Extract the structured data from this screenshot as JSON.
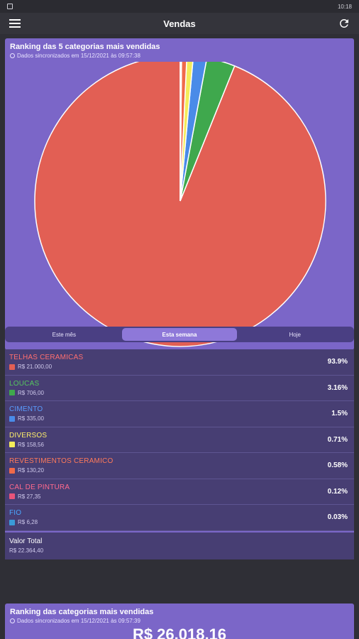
{
  "status": {
    "time": "10:18"
  },
  "appbar": {
    "title": "Vendas",
    "menu_icon": "menu-icon",
    "refresh_icon": "refresh-icon"
  },
  "card1": {
    "title": "Ranking das 5 categorias mais vendidas",
    "synced": "Dados sincronizados em 15/12/2021 às 09:57:38"
  },
  "chart_data": {
    "type": "pie",
    "slices": [
      {
        "label": "TELHAS CERAMICAS",
        "value": 93.9,
        "color": "#e25f54"
      },
      {
        "label": "LOUCAS",
        "value": 3.16,
        "color": "#3fa84d"
      },
      {
        "label": "CIMENTO",
        "value": 1.5,
        "color": "#4a8be8"
      },
      {
        "label": "DIVERSOS",
        "value": 0.71,
        "color": "#f4ec5a"
      },
      {
        "label": "REVESTIMENTOS CERAMICO",
        "value": 0.58,
        "color": "#f06a4a"
      },
      {
        "label": "CAL DE PINTURA",
        "value": 0.12,
        "color": "#e8547a"
      },
      {
        "label": "FIO",
        "value": 0.03,
        "color": "#3a9ad8"
      }
    ]
  },
  "period_tabs": [
    {
      "label": "Este mês",
      "active": false
    },
    {
      "label": "Esta semana",
      "active": true
    },
    {
      "label": "Hoje",
      "active": false
    }
  ],
  "categories": [
    {
      "name": "TELHAS CERAMICAS",
      "value": "R$ 21.000,00",
      "pct": "93.9%",
      "name_color": "#ff6f6f",
      "color": "#e25f54"
    },
    {
      "name": "LOUCAS",
      "value": "R$ 706,00",
      "pct": "3.16%",
      "name_color": "#55c65e",
      "color": "#3fa84d"
    },
    {
      "name": "CIMENTO",
      "value": "R$ 335,00",
      "pct": "1.5%",
      "name_color": "#5a9cff",
      "color": "#4a8be8"
    },
    {
      "name": "DIVERSOS",
      "value": "R$ 158,56",
      "pct": "0.71%",
      "name_color": "#fff06a",
      "color": "#f4ec5a"
    },
    {
      "name": "REVESTIMENTOS CERAMICO",
      "value": "R$ 130,20",
      "pct": "0.58%",
      "name_color": "#ff7a5a",
      "color": "#f06a4a"
    },
    {
      "name": "CAL DE PINTURA",
      "value": "R$ 27,35",
      "pct": "0.12%",
      "name_color": "#ff6a8e",
      "color": "#e8547a"
    },
    {
      "name": "FIO",
      "value": "R$ 6,28",
      "pct": "0.03%",
      "name_color": "#4aa8ff",
      "color": "#3a9ad8"
    }
  ],
  "total": {
    "label": "Valor Total",
    "value": "R$ 22.364,40"
  },
  "card2": {
    "title": "Ranking das categorias mais vendidas",
    "synced": "Dados sincronizados em 15/12/2021 às 09:57:39",
    "amount": "R$ 26.018,16"
  }
}
